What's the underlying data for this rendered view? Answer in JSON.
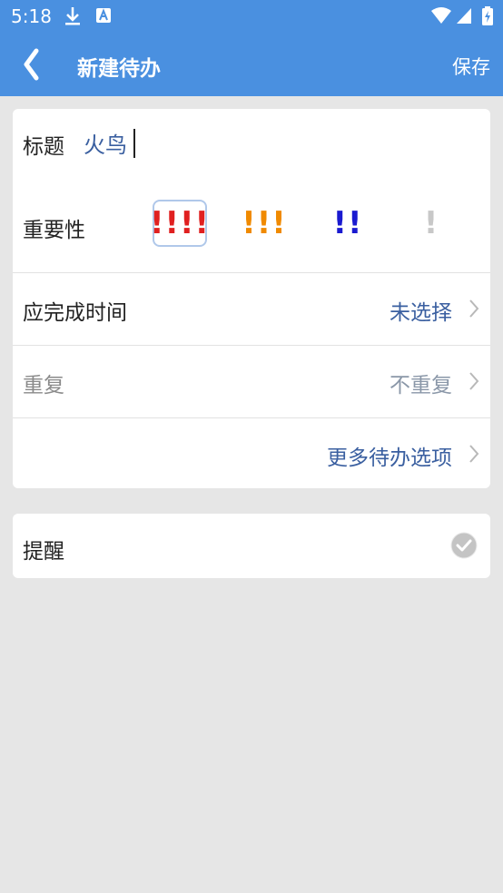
{
  "status": {
    "time": "5:18",
    "icons": [
      "download-icon",
      "a-badge-icon",
      "wifi-icon",
      "signal-icon",
      "battery-icon"
    ]
  },
  "header": {
    "title": "新建待办",
    "save_label": "保存",
    "back_icon": "chevron-left-icon"
  },
  "form": {
    "title_label": "标题",
    "title_value": "火鸟",
    "importance_label": "重要性",
    "importance_options": [
      {
        "label": "!!!!",
        "color": "#e02020",
        "selected": true
      },
      {
        "label": "!!!",
        "color": "#f08a00",
        "selected": false
      },
      {
        "label": "!!",
        "color": "#1a1ad0",
        "selected": false
      },
      {
        "label": "!",
        "color": "#c8c8c8",
        "selected": false
      }
    ],
    "due_label": "应完成时间",
    "due_value": "未选择",
    "repeat_label": "重复",
    "repeat_value": "不重复",
    "more_label": "更多待办选项"
  },
  "reminder": {
    "label": "提醒",
    "checked": true
  },
  "colors": {
    "accent": "#4a90e0",
    "value_text": "#3a5fa0",
    "muted_text": "#8a97a8"
  }
}
